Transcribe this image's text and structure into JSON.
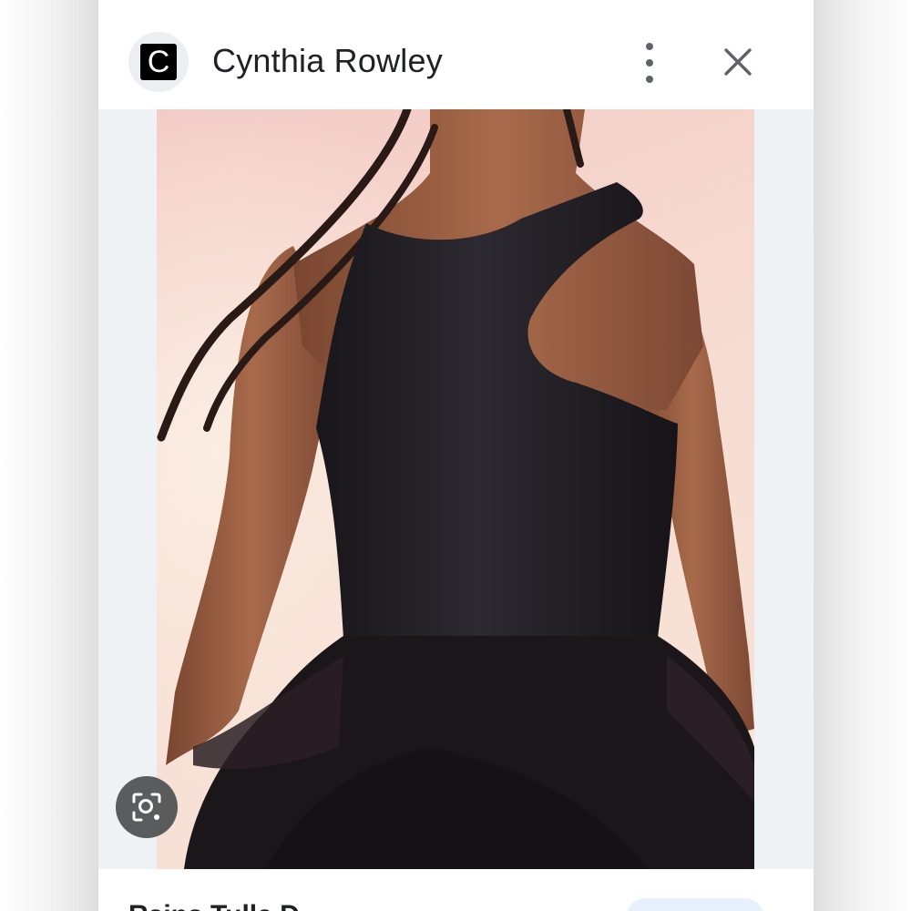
{
  "header": {
    "logo_letter": "C",
    "site_name": "Cynthia Rowley",
    "menu_icon": "more-vert-icon",
    "close_icon": "close-icon"
  },
  "image": {
    "lens_icon": "google-lens-icon"
  },
  "footer": {
    "title": "Rains Tulle D..."
  },
  "colors": {
    "header_bg": "#ffffff",
    "frame_bg": "#eef2f4",
    "text": "#202124",
    "icon": "#5f6368"
  }
}
